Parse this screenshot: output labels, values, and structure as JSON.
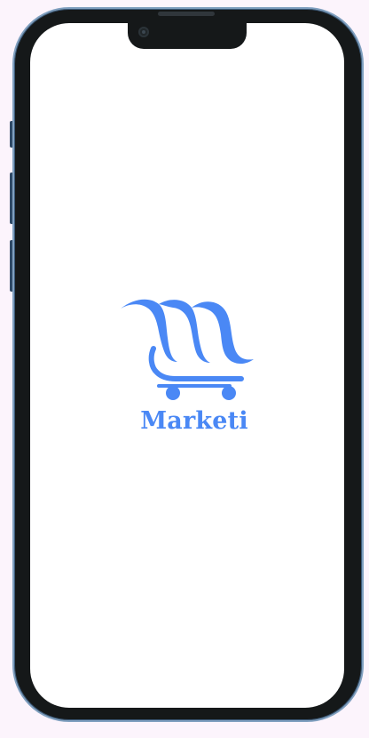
{
  "app": {
    "brand_name": "Marketi",
    "logo_icon": "shopping-cart-m-logo-icon"
  },
  "colors": {
    "brand_blue": "#4a88f5",
    "frame": "#151819",
    "frame_edge": "#7f9fbf",
    "background": "#fcf4fc",
    "screen": "#ffffff"
  }
}
